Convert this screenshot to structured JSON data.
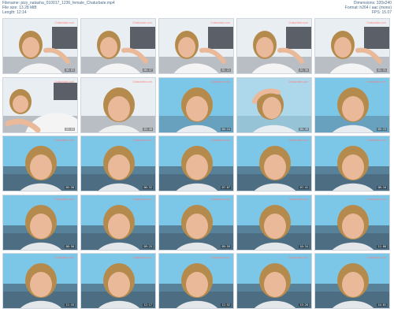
{
  "header": {
    "filename": "Filename: pizy_natasha_010017_1236_female_Chaturbate.mp4",
    "filesize": "File size: 13.28 MiB",
    "length": "Length: 12:14",
    "dimensions": "Dimensions: 320x240",
    "format": "Format: h264 / aac (mono)",
    "fps": "FPS: 15.07"
  },
  "thumbnails": [
    {
      "timestamp": "00:03",
      "watermark": "Chaturbate.com",
      "scene": "white-top-hand"
    },
    {
      "timestamp": "00:47",
      "watermark": "Chaturbate.com",
      "scene": "white-top-hand"
    },
    {
      "timestamp": "01:22",
      "watermark": "Chaturbate.com",
      "scene": "white-top-hand"
    },
    {
      "timestamp": "01:56",
      "watermark": "Chaturbate.com",
      "scene": "white-top-hand"
    },
    {
      "timestamp": "02:31",
      "watermark": "Chaturbate.com",
      "scene": "white-top-hand"
    },
    {
      "timestamp": "03:05",
      "watermark": "Chaturbate.com",
      "scene": "lying-white"
    },
    {
      "timestamp": "03:40",
      "watermark": "Chaturbate.com",
      "scene": "closeup"
    },
    {
      "timestamp": "04:14",
      "watermark": "Chaturbate.com",
      "scene": "closeup-blue"
    },
    {
      "timestamp": "04:49",
      "watermark": "Chaturbate.com",
      "scene": "hand-head"
    },
    {
      "timestamp": "05:23",
      "watermark": "Chaturbate.com",
      "scene": "closeup-blue"
    },
    {
      "timestamp": "05:58",
      "watermark": "Chaturbate.com",
      "scene": "blue-wall"
    },
    {
      "timestamp": "06:32",
      "watermark": "Chaturbate.com",
      "scene": "blue-wall"
    },
    {
      "timestamp": "07:07",
      "watermark": "Chaturbate.com",
      "scene": "blue-wall"
    },
    {
      "timestamp": "07:41",
      "watermark": "Chaturbate.com",
      "scene": "blue-wall"
    },
    {
      "timestamp": "08:16",
      "watermark": "Chaturbate.com",
      "scene": "blue-wall"
    },
    {
      "timestamp": "08:50",
      "watermark": "Chaturbate.com",
      "scene": "blue-wall"
    },
    {
      "timestamp": "09:25",
      "watermark": "Chaturbate.com",
      "scene": "blue-wall"
    },
    {
      "timestamp": "09:59",
      "watermark": "Chaturbate.com",
      "scene": "blue-wall"
    },
    {
      "timestamp": "10:34",
      "watermark": "Chaturbate.com",
      "scene": "blue-wall"
    },
    {
      "timestamp": "11:08",
      "watermark": "Chaturbate.com",
      "scene": "blue-wall"
    },
    {
      "timestamp": "11:43",
      "watermark": "Chaturbate.com",
      "scene": "blue-wall"
    },
    {
      "timestamp": "12:17",
      "watermark": "Chaturbate.com",
      "scene": "blue-wall"
    },
    {
      "timestamp": "12:52",
      "watermark": "Chaturbate.com",
      "scene": "blue-wall"
    },
    {
      "timestamp": "13:26",
      "watermark": "Chaturbate.com",
      "scene": "blue-wall"
    },
    {
      "timestamp": "14:01",
      "watermark": "Chaturbate.com",
      "scene": "blue-wall"
    }
  ],
  "colors": {
    "header_text": "#4a6a8a",
    "wall_white": "#e9eef2",
    "wall_blue": "#7cc7e8",
    "pillow_dark": "#2a2f3a",
    "hair": "#b58b4d",
    "skin": "#e9b99a",
    "top_white": "#f4f4f4"
  }
}
